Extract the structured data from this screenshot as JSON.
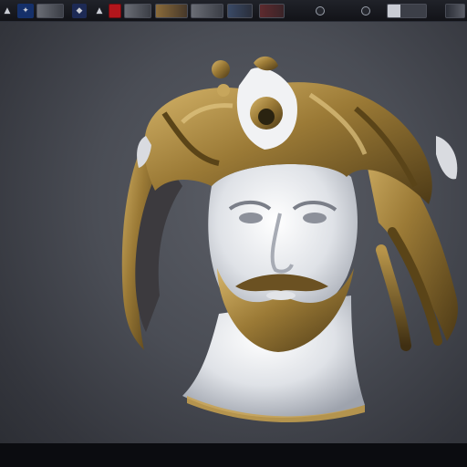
{
  "toolbar": {
    "items": [
      {
        "icon": "triangle-icon",
        "glyph": "A"
      },
      {
        "icon": "app-icon",
        "glyph": "✦"
      },
      {
        "icon": "thumbnail-icon",
        "glyph": ""
      },
      {
        "icon": "image-icon",
        "glyph": "◆"
      },
      {
        "icon": "triangle-icon",
        "glyph": "▲"
      },
      {
        "icon": "red-thumbnail-icon",
        "glyph": ""
      },
      {
        "icon": "thumbnail-icon",
        "glyph": ""
      },
      {
        "icon": "thumbnail-icon",
        "glyph": ""
      },
      {
        "icon": "thumbnail-icon",
        "glyph": ""
      },
      {
        "icon": "thumbnail-icon",
        "glyph": ""
      },
      {
        "icon": "thumbnail-icon",
        "glyph": ""
      },
      {
        "icon": "record-icon",
        "glyph": ""
      },
      {
        "icon": "circle-icon",
        "glyph": ""
      },
      {
        "icon": "thumbnail-icon",
        "glyph": ""
      },
      {
        "icon": "thumbnail-icon",
        "glyph": ""
      }
    ]
  },
  "colors": {
    "accent_red": "#b3161c",
    "gold": "#9b7a36",
    "marble": "#e9ebee",
    "backdrop": "#4a4d55"
  },
  "viewport": {
    "subject": "3d-bust-render"
  }
}
